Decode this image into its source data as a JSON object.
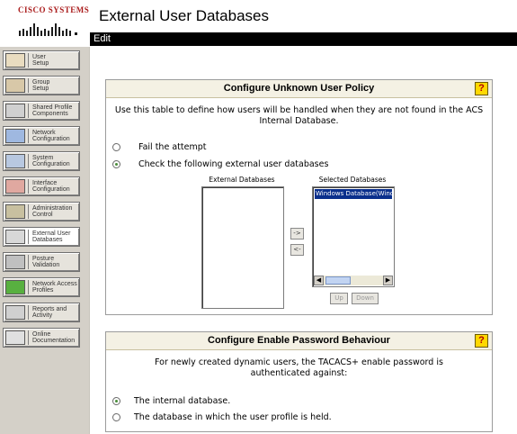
{
  "logo": {
    "text": "Cisco Systems"
  },
  "page": {
    "title": "External User Databases"
  },
  "menubar": {
    "edit": "Edit"
  },
  "nav": {
    "items": [
      {
        "label": "User\nSetup",
        "icon": "user-setup-icon"
      },
      {
        "label": "Group\nSetup",
        "icon": "group-setup-icon"
      },
      {
        "label": "Shared Profile\nComponents",
        "icon": "shared-profile-icon"
      },
      {
        "label": "Network\nConfiguration",
        "icon": "network-config-icon"
      },
      {
        "label": "System\nConfiguration",
        "icon": "system-config-icon"
      },
      {
        "label": "Interface\nConfiguration",
        "icon": "interface-config-icon"
      },
      {
        "label": "Administration\nControl",
        "icon": "admin-control-icon"
      },
      {
        "label": "External User\nDatabases",
        "icon": "external-db-icon"
      },
      {
        "label": "Posture\nValidation",
        "icon": "posture-validation-icon"
      },
      {
        "label": "Network Access\nProfiles",
        "icon": "network-access-icon"
      },
      {
        "label": "Reports and\nActivity",
        "icon": "reports-icon"
      },
      {
        "label": "Online\nDocumentation",
        "icon": "documentation-icon"
      }
    ]
  },
  "unknown_policy": {
    "title": "Configure Unknown User Policy",
    "help": "?",
    "description": "Use this table to define how users will be handled when they are not found in the ACS Internal Database.",
    "option_fail": "Fail the attempt",
    "option_check": "Check the following external user databases",
    "selected_option": "check",
    "external_label": "External Databases",
    "selected_label": "Selected Databases",
    "external_items": [],
    "selected_items": [
      "Windows Database(Windo"
    ],
    "move_right": "->",
    "move_left": "<-",
    "up": "Up",
    "down": "Down"
  },
  "enable_password": {
    "title": "Configure Enable Password Behaviour",
    "help": "?",
    "description": "For newly created dynamic users, the TACACS+ enable password is authenticated against:",
    "option_internal": "The internal database.",
    "option_profile": "The database in which the user profile is held.",
    "selected_option": "internal"
  },
  "colors": {
    "menubar": "#000000",
    "nav_bg": "#d4d0c8",
    "panel_head": "#f4f1e4",
    "selection": "#0a2f8c",
    "help": "#ffd800"
  }
}
